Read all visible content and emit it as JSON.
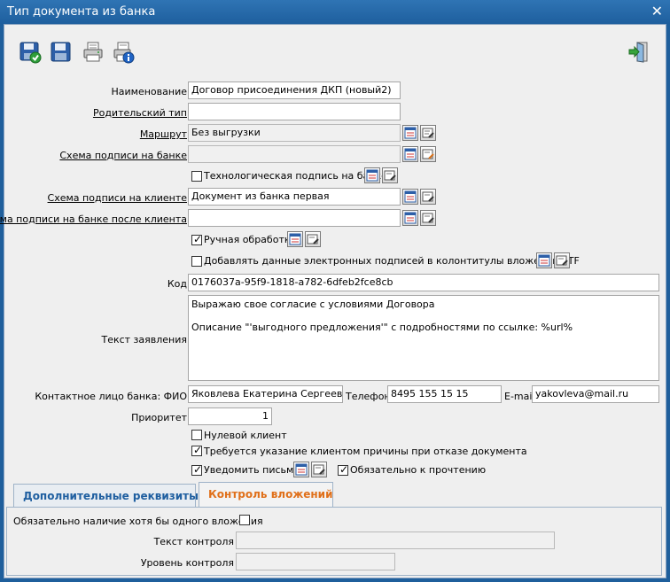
{
  "window": {
    "title": "Тип документа из банка"
  },
  "toolbar": {
    "icons": [
      "save-check-icon",
      "save-icon",
      "print-icon",
      "print-info-icon",
      "exit-icon"
    ]
  },
  "form": {
    "name_label": "Наименование",
    "name_value": "Договор присоединения ДКП (новый2)",
    "parent_label": "Родительский тип",
    "parent_value": "",
    "route_label": "Маршрут",
    "route_value": "Без выгрузки",
    "bank_sign_label": "Схема подписи на банке",
    "bank_sign_value": "",
    "tech_sign_label": "Технологическая подпись на банке",
    "client_sign_label": "Схема подписи на клиенте",
    "client_sign_value": "Документ из банка  первая",
    "after_client_label": "Схема подписи на банке после клиента",
    "after_client_value": "",
    "manual_label": "Ручная обработка",
    "add_sign_label": "Добавлять данные электронных подписей в колонтитулы вложений RTF",
    "code_label": "Код",
    "code_value": "0176037a-95f9-1818-a782-6dfeb2fce8cb",
    "statement_label": "Текст заявления",
    "statement_line1": "Выражаю свое согласие с условиями Договора",
    "statement_line2": "Описание \"'выгодного предложения'\" с подробностями по ссылке: %url%",
    "contact_label": "Контактное лицо банка: ФИО",
    "contact_value": "Яковлева Екатерина Сергеевна",
    "phone_label": "Телефон",
    "phone_value": "8495 155 15 15",
    "email_label": "E-mail",
    "email_value": "yakovleva@mail.ru",
    "priority_label": "Приоритет",
    "priority_value": "1",
    "zero_client_label": "Нулевой клиент",
    "reason_label": "Требуется указание клиентом причины при отказе документа",
    "notify_label": "Уведомить письмом",
    "mandatory_read_label": "Обязательно к прочтению"
  },
  "checkboxes": {
    "tech_sign": false,
    "manual": true,
    "add_sign": false,
    "zero_client": false,
    "reason": true,
    "notify": true,
    "mandatory_read": true,
    "attach_required": false
  },
  "tabs": [
    {
      "label": "Дополнительные реквизиты",
      "active": false
    },
    {
      "label": "Контроль вложений",
      "active": true
    }
  ],
  "attach": {
    "required_label": "Обязательно наличие хотя бы одного вложения",
    "control_text_label": "Текст контроля",
    "control_text_value": "",
    "control_level_label": "Уровень контроля",
    "control_level_value": ""
  },
  "colors": {
    "title_bar": "#1f5f9c",
    "tab_active_text": "#e0701a",
    "tab_inactive_text": "#1f5fa0"
  }
}
